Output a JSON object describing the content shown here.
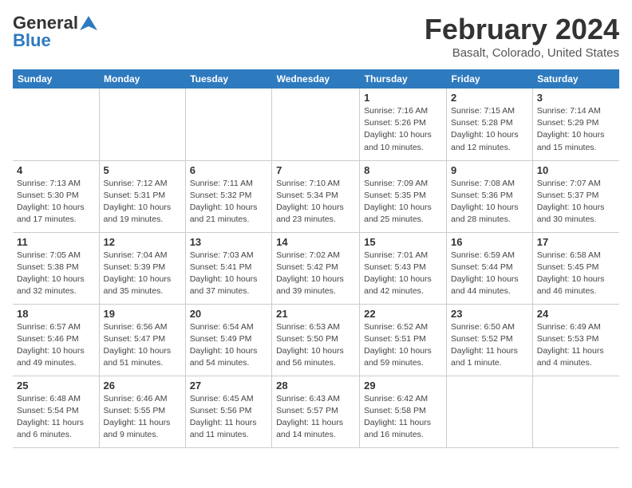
{
  "header": {
    "logo_general": "General",
    "logo_blue": "Blue",
    "main_title": "February 2024",
    "subtitle": "Basalt, Colorado, United States"
  },
  "calendar": {
    "days_of_week": [
      "Sunday",
      "Monday",
      "Tuesday",
      "Wednesday",
      "Thursday",
      "Friday",
      "Saturday"
    ],
    "weeks": [
      [
        {
          "date": "",
          "info": ""
        },
        {
          "date": "",
          "info": ""
        },
        {
          "date": "",
          "info": ""
        },
        {
          "date": "",
          "info": ""
        },
        {
          "date": "1",
          "sunrise": "Sunrise: 7:16 AM",
          "sunset": "Sunset: 5:26 PM",
          "daylight": "Daylight: 10 hours and 10 minutes."
        },
        {
          "date": "2",
          "sunrise": "Sunrise: 7:15 AM",
          "sunset": "Sunset: 5:28 PM",
          "daylight": "Daylight: 10 hours and 12 minutes."
        },
        {
          "date": "3",
          "sunrise": "Sunrise: 7:14 AM",
          "sunset": "Sunset: 5:29 PM",
          "daylight": "Daylight: 10 hours and 15 minutes."
        }
      ],
      [
        {
          "date": "4",
          "sunrise": "Sunrise: 7:13 AM",
          "sunset": "Sunset: 5:30 PM",
          "daylight": "Daylight: 10 hours and 17 minutes."
        },
        {
          "date": "5",
          "sunrise": "Sunrise: 7:12 AM",
          "sunset": "Sunset: 5:31 PM",
          "daylight": "Daylight: 10 hours and 19 minutes."
        },
        {
          "date": "6",
          "sunrise": "Sunrise: 7:11 AM",
          "sunset": "Sunset: 5:32 PM",
          "daylight": "Daylight: 10 hours and 21 minutes."
        },
        {
          "date": "7",
          "sunrise": "Sunrise: 7:10 AM",
          "sunset": "Sunset: 5:34 PM",
          "daylight": "Daylight: 10 hours and 23 minutes."
        },
        {
          "date": "8",
          "sunrise": "Sunrise: 7:09 AM",
          "sunset": "Sunset: 5:35 PM",
          "daylight": "Daylight: 10 hours and 25 minutes."
        },
        {
          "date": "9",
          "sunrise": "Sunrise: 7:08 AM",
          "sunset": "Sunset: 5:36 PM",
          "daylight": "Daylight: 10 hours and 28 minutes."
        },
        {
          "date": "10",
          "sunrise": "Sunrise: 7:07 AM",
          "sunset": "Sunset: 5:37 PM",
          "daylight": "Daylight: 10 hours and 30 minutes."
        }
      ],
      [
        {
          "date": "11",
          "sunrise": "Sunrise: 7:05 AM",
          "sunset": "Sunset: 5:38 PM",
          "daylight": "Daylight: 10 hours and 32 minutes."
        },
        {
          "date": "12",
          "sunrise": "Sunrise: 7:04 AM",
          "sunset": "Sunset: 5:39 PM",
          "daylight": "Daylight: 10 hours and 35 minutes."
        },
        {
          "date": "13",
          "sunrise": "Sunrise: 7:03 AM",
          "sunset": "Sunset: 5:41 PM",
          "daylight": "Daylight: 10 hours and 37 minutes."
        },
        {
          "date": "14",
          "sunrise": "Sunrise: 7:02 AM",
          "sunset": "Sunset: 5:42 PM",
          "daylight": "Daylight: 10 hours and 39 minutes."
        },
        {
          "date": "15",
          "sunrise": "Sunrise: 7:01 AM",
          "sunset": "Sunset: 5:43 PM",
          "daylight": "Daylight: 10 hours and 42 minutes."
        },
        {
          "date": "16",
          "sunrise": "Sunrise: 6:59 AM",
          "sunset": "Sunset: 5:44 PM",
          "daylight": "Daylight: 10 hours and 44 minutes."
        },
        {
          "date": "17",
          "sunrise": "Sunrise: 6:58 AM",
          "sunset": "Sunset: 5:45 PM",
          "daylight": "Daylight: 10 hours and 46 minutes."
        }
      ],
      [
        {
          "date": "18",
          "sunrise": "Sunrise: 6:57 AM",
          "sunset": "Sunset: 5:46 PM",
          "daylight": "Daylight: 10 hours and 49 minutes."
        },
        {
          "date": "19",
          "sunrise": "Sunrise: 6:56 AM",
          "sunset": "Sunset: 5:47 PM",
          "daylight": "Daylight: 10 hours and 51 minutes."
        },
        {
          "date": "20",
          "sunrise": "Sunrise: 6:54 AM",
          "sunset": "Sunset: 5:49 PM",
          "daylight": "Daylight: 10 hours and 54 minutes."
        },
        {
          "date": "21",
          "sunrise": "Sunrise: 6:53 AM",
          "sunset": "Sunset: 5:50 PM",
          "daylight": "Daylight: 10 hours and 56 minutes."
        },
        {
          "date": "22",
          "sunrise": "Sunrise: 6:52 AM",
          "sunset": "Sunset: 5:51 PM",
          "daylight": "Daylight: 10 hours and 59 minutes."
        },
        {
          "date": "23",
          "sunrise": "Sunrise: 6:50 AM",
          "sunset": "Sunset: 5:52 PM",
          "daylight": "Daylight: 11 hours and 1 minute."
        },
        {
          "date": "24",
          "sunrise": "Sunrise: 6:49 AM",
          "sunset": "Sunset: 5:53 PM",
          "daylight": "Daylight: 11 hours and 4 minutes."
        }
      ],
      [
        {
          "date": "25",
          "sunrise": "Sunrise: 6:48 AM",
          "sunset": "Sunset: 5:54 PM",
          "daylight": "Daylight: 11 hours and 6 minutes."
        },
        {
          "date": "26",
          "sunrise": "Sunrise: 6:46 AM",
          "sunset": "Sunset: 5:55 PM",
          "daylight": "Daylight: 11 hours and 9 minutes."
        },
        {
          "date": "27",
          "sunrise": "Sunrise: 6:45 AM",
          "sunset": "Sunset: 5:56 PM",
          "daylight": "Daylight: 11 hours and 11 minutes."
        },
        {
          "date": "28",
          "sunrise": "Sunrise: 6:43 AM",
          "sunset": "Sunset: 5:57 PM",
          "daylight": "Daylight: 11 hours and 14 minutes."
        },
        {
          "date": "29",
          "sunrise": "Sunrise: 6:42 AM",
          "sunset": "Sunset: 5:58 PM",
          "daylight": "Daylight: 11 hours and 16 minutes."
        },
        {
          "date": "",
          "info": ""
        },
        {
          "date": "",
          "info": ""
        }
      ]
    ]
  }
}
